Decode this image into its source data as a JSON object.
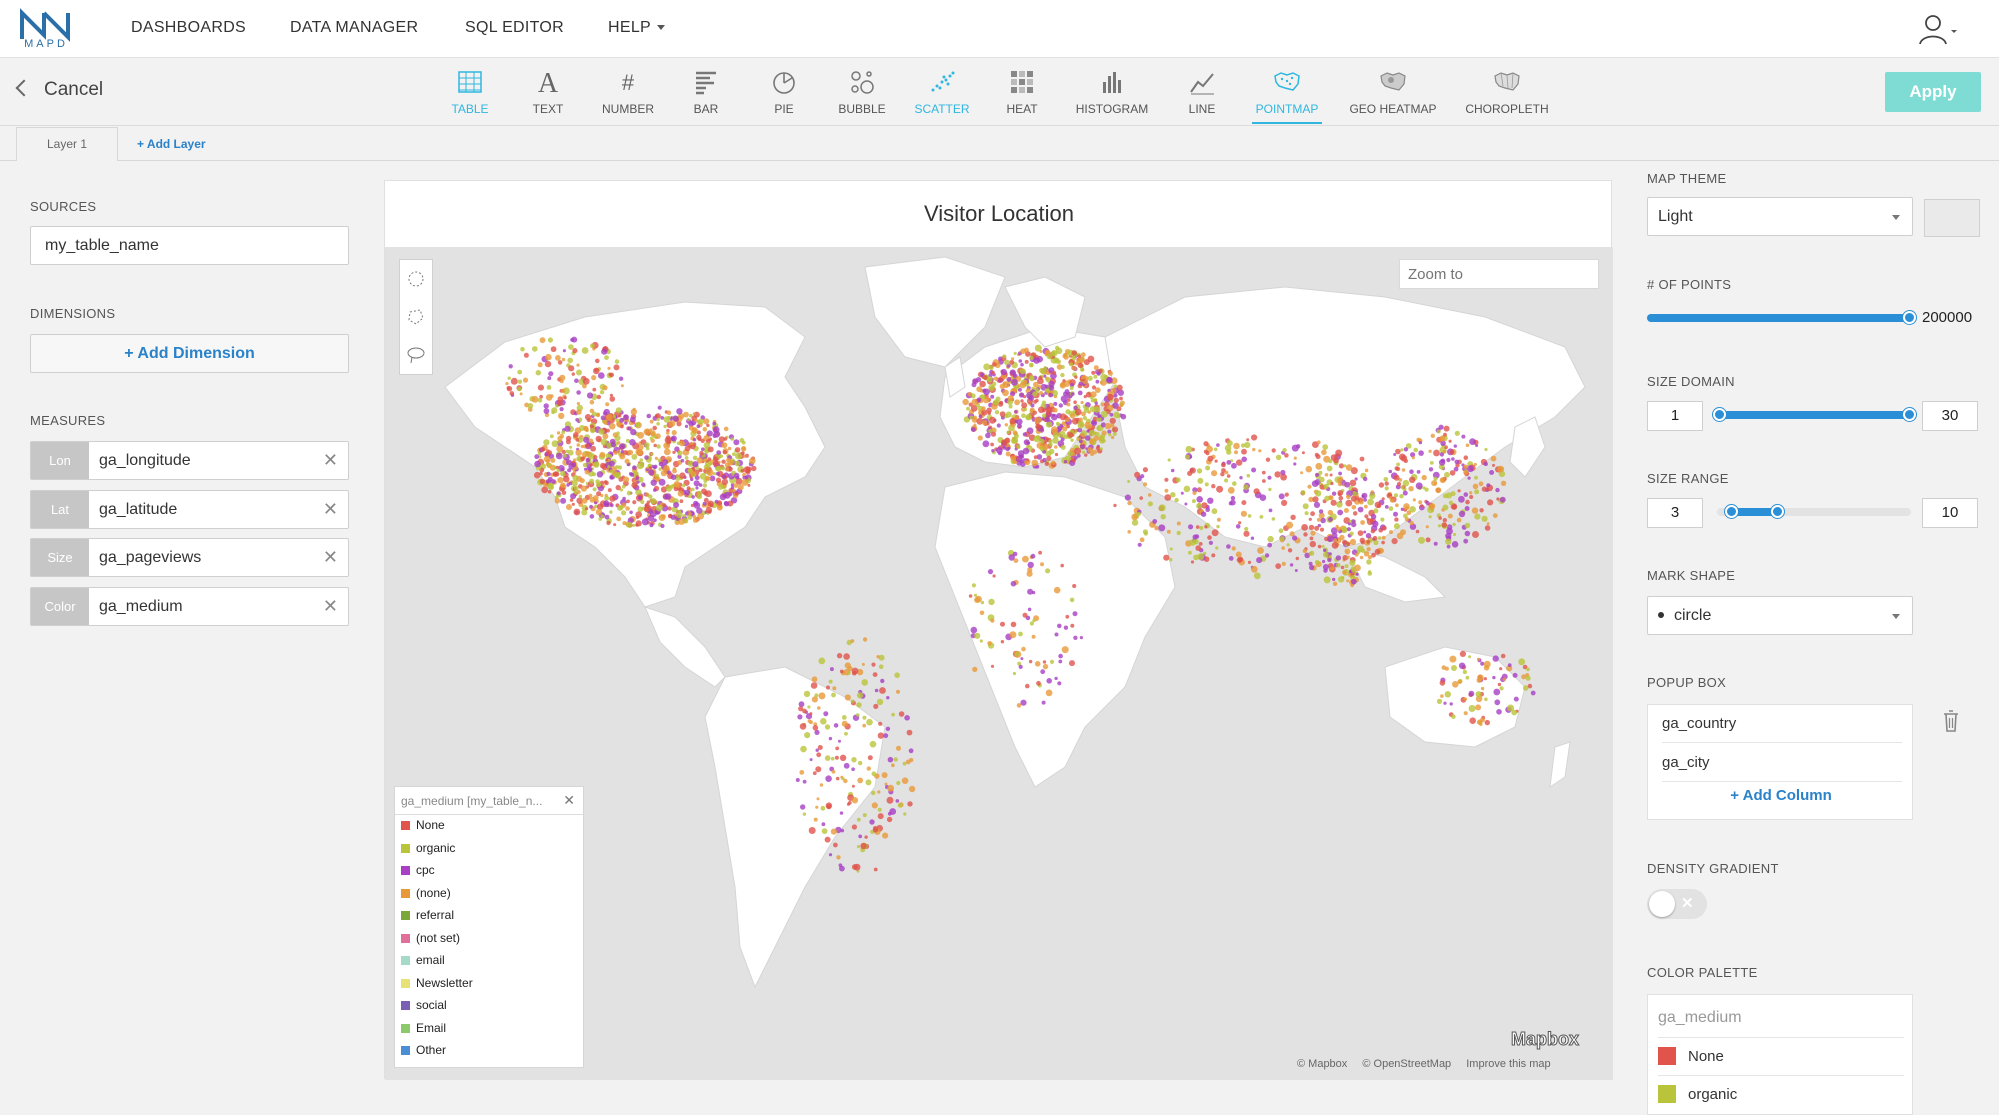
{
  "app": {
    "logo_text": "MAPD",
    "nav": [
      "DASHBOARDS",
      "DATA MANAGER",
      "SQL EDITOR",
      "HELP"
    ]
  },
  "toolbar": {
    "cancel_label": "Cancel",
    "apply_label": "Apply",
    "chart_types": [
      {
        "label": "TABLE",
        "icon": "table-icon"
      },
      {
        "label": "TEXT",
        "icon": "text-icon"
      },
      {
        "label": "NUMBER",
        "icon": "number-icon"
      },
      {
        "label": "BAR",
        "icon": "bar-icon"
      },
      {
        "label": "PIE",
        "icon": "pie-icon"
      },
      {
        "label": "BUBBLE",
        "icon": "bubble-icon"
      },
      {
        "label": "SCATTER",
        "icon": "scatter-icon"
      },
      {
        "label": "HEAT",
        "icon": "heat-icon"
      },
      {
        "label": "HISTOGRAM",
        "icon": "histogram-icon"
      },
      {
        "label": "LINE",
        "icon": "line-icon"
      },
      {
        "label": "POINTMAP",
        "icon": "pointmap-icon"
      },
      {
        "label": "GEO HEATMAP",
        "icon": "geo-heatmap-icon"
      },
      {
        "label": "CHOROPLETH",
        "icon": "choropleth-icon"
      }
    ],
    "selected": "POINTMAP"
  },
  "layers": {
    "tab_label": "Layer 1",
    "add_label": "+ Add Layer"
  },
  "left": {
    "sources_label": "SOURCES",
    "source_value": "my_table_name",
    "dimensions_label": "DIMENSIONS",
    "add_dimension_label": "+ Add Dimension",
    "measures_label": "MEASURES",
    "measures": [
      {
        "tag": "Lon",
        "value": "ga_longitude"
      },
      {
        "tag": "Lat",
        "value": "ga_latitude"
      },
      {
        "tag": "Size",
        "value": "ga_pageviews"
      },
      {
        "tag": "Color",
        "value": "ga_medium"
      }
    ]
  },
  "map": {
    "title": "Visitor Location",
    "zoom_placeholder": "Zoom to",
    "legend_title": "ga_medium [my_table_n...",
    "legend": [
      {
        "label": "None",
        "color": "#e0544b"
      },
      {
        "label": "organic",
        "color": "#b9c43a"
      },
      {
        "label": "cpc",
        "color": "#a83fc4"
      },
      {
        "label": "(none)",
        "color": "#e89a3a"
      },
      {
        "label": "referral",
        "color": "#7aa63a"
      },
      {
        "label": "(not set)",
        "color": "#e0709a"
      },
      {
        "label": "email",
        "color": "#a5d9c8"
      },
      {
        "label": "Newsletter",
        "color": "#e6e276"
      },
      {
        "label": "social",
        "color": "#7a5fb5"
      },
      {
        "label": "Email",
        "color": "#8cc96a"
      },
      {
        "label": "Other",
        "color": "#4a8fd6"
      }
    ],
    "brand": "Mapbox",
    "attribution": [
      "© Mapbox",
      "© OpenStreetMap",
      "Improve this map"
    ]
  },
  "right": {
    "map_theme_label": "MAP THEME",
    "map_theme_value": "Light",
    "points_label": "# OF POINTS",
    "points_value": "200000",
    "points_fraction": 1.0,
    "size_domain_label": "SIZE DOMAIN",
    "size_domain_min": "1",
    "size_domain_max": "30",
    "size_range_label": "SIZE RANGE",
    "size_range_min": "3",
    "size_range_max": "10",
    "mark_shape_label": "MARK SHAPE",
    "mark_shape_value": "circle",
    "popup_label": "POPUP BOX",
    "popup_columns": [
      "ga_country",
      "ga_city"
    ],
    "add_column_label": "+ Add Column",
    "density_label": "DENSITY GRADIENT",
    "density_on": false,
    "palette_label": "COLOR PALETTE",
    "palette_title": "ga_medium",
    "palette": [
      {
        "label": "None",
        "color": "#e0544b"
      },
      {
        "label": "organic",
        "color": "#b9c43a"
      }
    ]
  },
  "colors": {
    "accent": "#2fb7e0",
    "apply": "#7fdcd4",
    "link": "#2a82c9",
    "slider": "#2a8fd6"
  }
}
